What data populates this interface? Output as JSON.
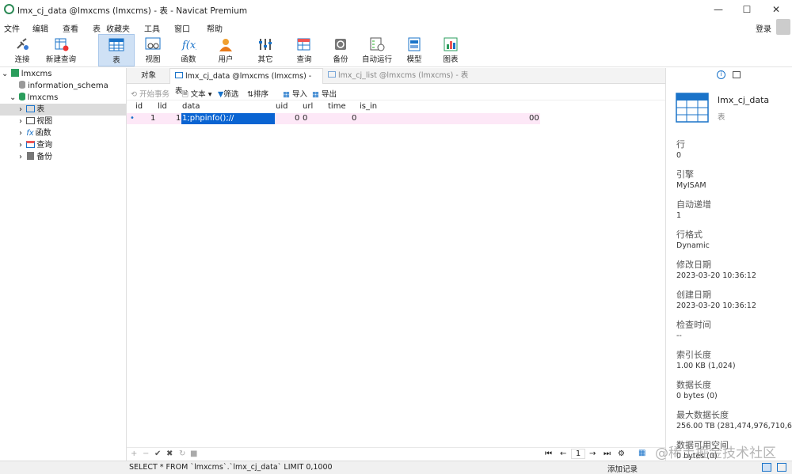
{
  "window": {
    "title": "lmx_cj_data @lmxcms (lmxcms) - 表 - Navicat Premium",
    "min": "—",
    "max": "☐",
    "close": "✕"
  },
  "menu": [
    "文件",
    "编辑",
    "查看",
    "表",
    "收藏夹",
    "工具",
    "窗口",
    "帮助"
  ],
  "login": "登录",
  "toolbar": [
    {
      "label": "连接",
      "icon": "connection-icon"
    },
    {
      "label": "新建查询",
      "icon": "new-query-icon"
    },
    {
      "label": "表",
      "icon": "table-icon"
    },
    {
      "label": "视图",
      "icon": "view-icon"
    },
    {
      "label": "函数",
      "icon": "function-icon"
    },
    {
      "label": "用户",
      "icon": "user-icon"
    },
    {
      "label": "其它",
      "icon": "other-icon"
    },
    {
      "label": "查询",
      "icon": "query-icon"
    },
    {
      "label": "备份",
      "icon": "backup-icon"
    },
    {
      "label": "自动运行",
      "icon": "auto-run-icon"
    },
    {
      "label": "模型",
      "icon": "model-icon"
    },
    {
      "label": "图表",
      "icon": "chart-icon"
    }
  ],
  "sidebar": {
    "connection": "lmxcms",
    "databases": [
      "information_schema",
      "lmxcms"
    ],
    "items": [
      "表",
      "视图",
      "函数",
      "查询",
      "备份"
    ]
  },
  "tabs": [
    "对象",
    "lmx_cj_data @lmxcms (lmxcms) - 表",
    "lmx_cj_list @lmxcms (lmxcms) - 表"
  ],
  "data_toolbar": {
    "begin": "开始事务",
    "text": "文本",
    "filter": "筛选",
    "sort": "排序",
    "import": "导入",
    "export": "导出"
  },
  "grid": {
    "columns": [
      "id",
      "lid",
      "data",
      "uid",
      "url",
      "time",
      "is_in"
    ],
    "row": {
      "marker": "•",
      "id": "1",
      "lid": "1",
      "data": "1;phpinfo();//",
      "uid": "0",
      "url": "0",
      "time": "0",
      "is_in": "00"
    }
  },
  "pager": {
    "page": "1"
  },
  "status": {
    "sql": "SELECT * FROM `lmxcms`.`lmx_cj_data` LIMIT 0,1000",
    "add_record": "添加记录"
  },
  "panel": {
    "name": "lmx_cj_data",
    "type": "表",
    "props": [
      {
        "label": "行",
        "value": "0"
      },
      {
        "label": "引擎",
        "value": "MyISAM"
      },
      {
        "label": "自动递增",
        "value": "1"
      },
      {
        "label": "行格式",
        "value": "Dynamic"
      },
      {
        "label": "修改日期",
        "value": "2023-03-20 10:36:12"
      },
      {
        "label": "创建日期",
        "value": "2023-03-20 10:36:12"
      },
      {
        "label": "检查时间",
        "value": "--"
      },
      {
        "label": "索引长度",
        "value": "1.00 KB (1,024)"
      },
      {
        "label": "数据长度",
        "value": "0 bytes (0)"
      },
      {
        "label": "最大数据长度",
        "value": "256.00 TB (281,474,976,710,6"
      },
      {
        "label": "数据可用空间",
        "value": "0 bytes (0)"
      }
    ]
  },
  "watermark": "@稀土掘金技术社区",
  "colors": {
    "accent": "#1a73c9",
    "row": "#fde8f7",
    "selected": "#0a64d2"
  }
}
